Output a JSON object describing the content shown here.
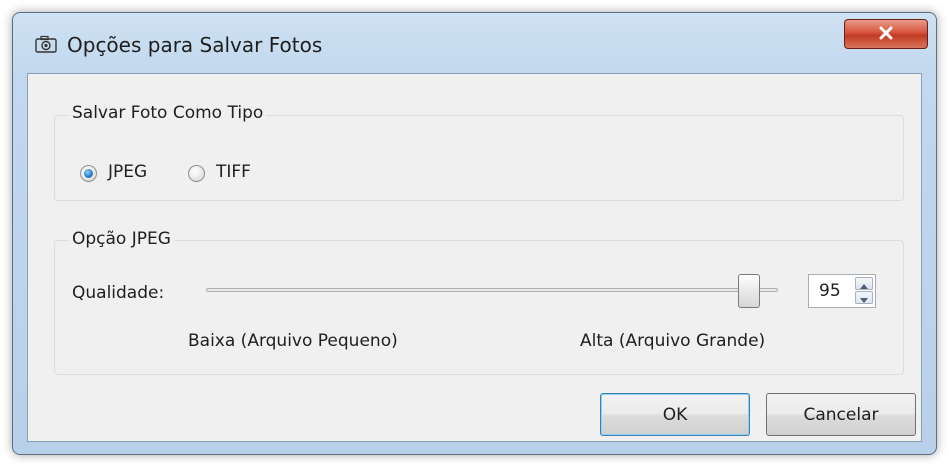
{
  "window": {
    "title": "Opções para Salvar Fotos",
    "icon": "camera-icon",
    "close_icon": "close-icon"
  },
  "file_type_group": {
    "title": "Salvar Foto Como Tipo",
    "options": [
      {
        "label": "JPEG",
        "selected": true
      },
      {
        "label": "TIFF",
        "selected": false
      }
    ]
  },
  "jpeg_group": {
    "title": "Opção JPEG",
    "quality_label": "Qualidade:",
    "slider_min_label": "Baixa (Arquivo Pequeno)",
    "slider_max_label": "Alta (Arquivo Grande)",
    "quality_value": "95",
    "quality_fraction": 0.95
  },
  "buttons": {
    "ok": "OK",
    "cancel": "Cancelar"
  },
  "colors": {
    "close_button": "#c9452c",
    "default_button_border": "#3c7fb1",
    "radio_selected": "#2a7fc9"
  }
}
